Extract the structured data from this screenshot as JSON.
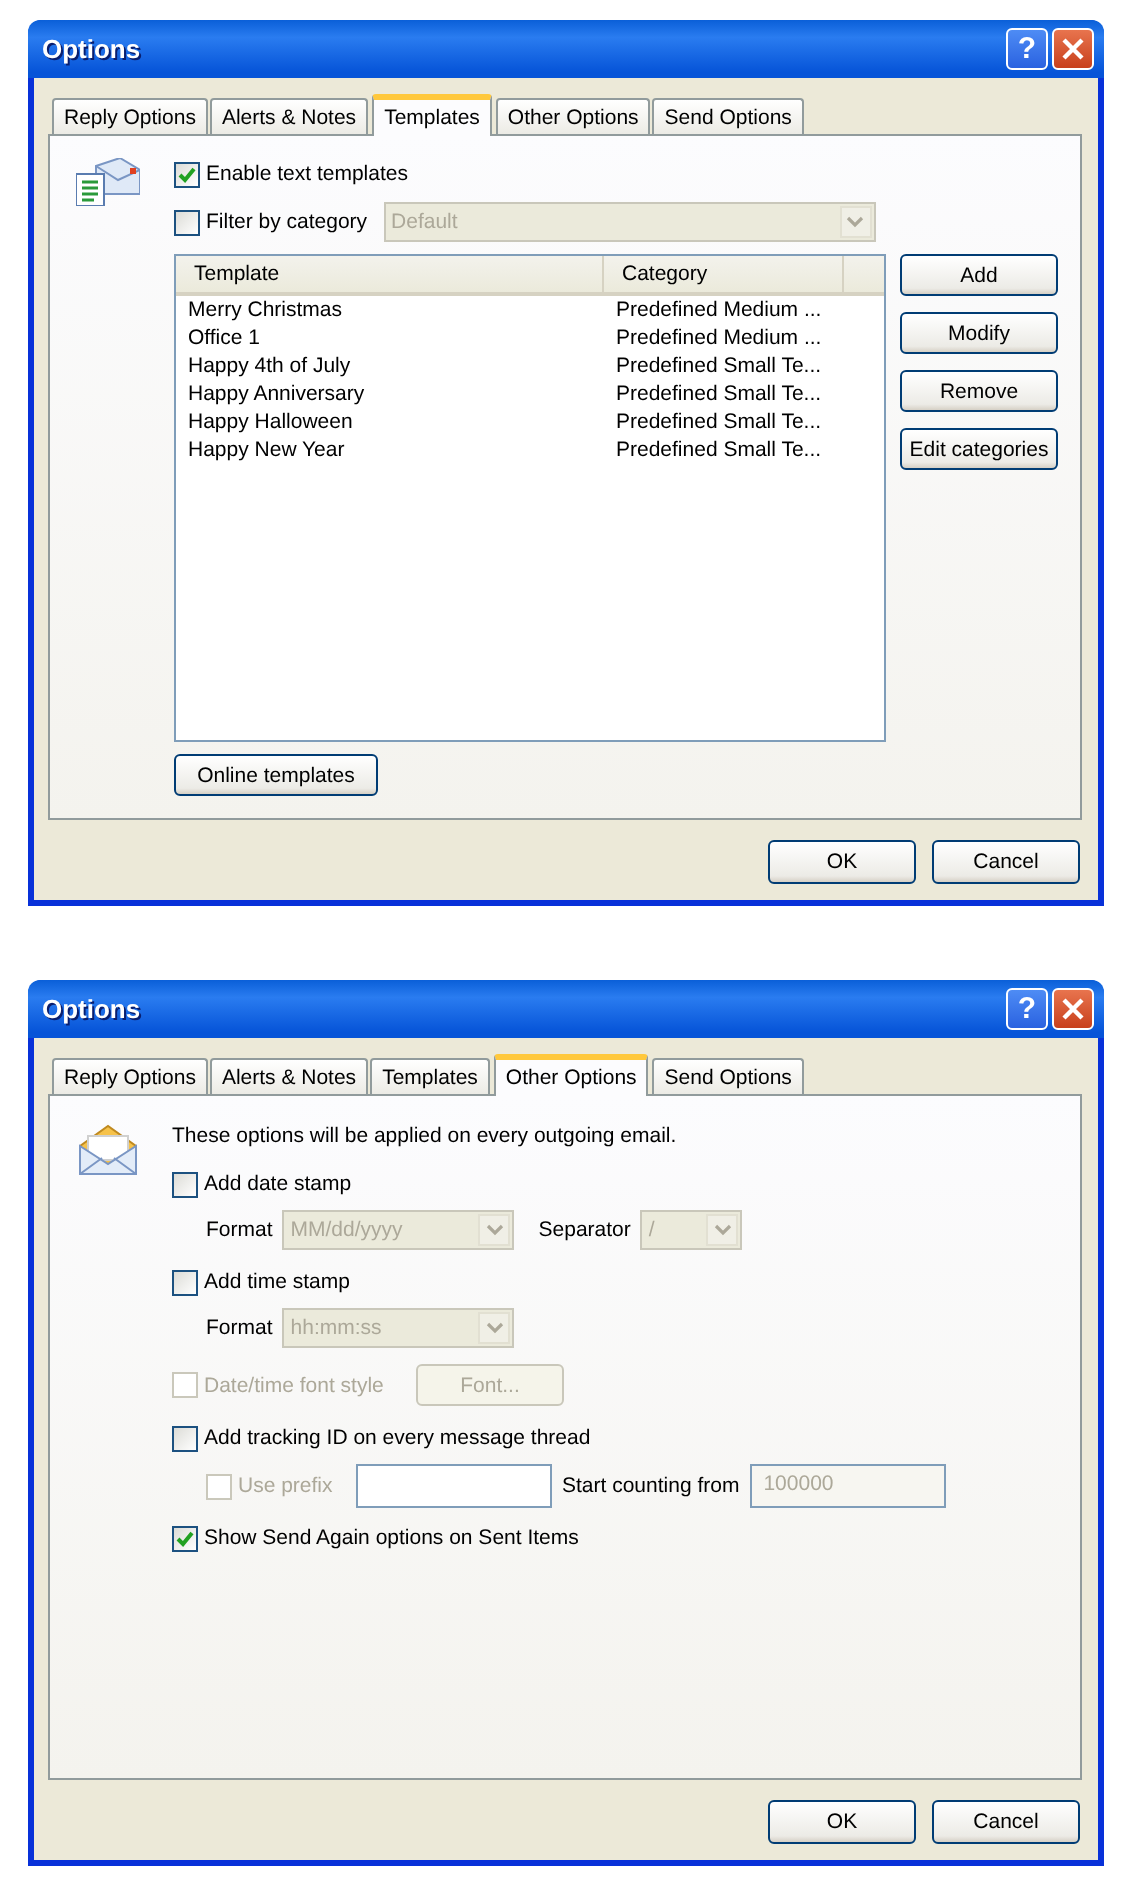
{
  "dialogs": [
    {
      "title": "Options",
      "help_glyph": "?",
      "tabs": [
        {
          "label": "Reply Options",
          "selected": false
        },
        {
          "label": "Alerts & Notes",
          "selected": false
        },
        {
          "label": "Templates",
          "selected": true
        },
        {
          "label": "Other Options",
          "selected": false
        },
        {
          "label": "Send Options",
          "selected": false
        }
      ],
      "page": {
        "kind": "templates",
        "enable": {
          "label": "Enable text templates",
          "checked": true
        },
        "filter": {
          "label": "Filter by category",
          "checked": false
        },
        "category_dropdown": {
          "value": "Default",
          "disabled": true
        },
        "columns": [
          "Template",
          "Category"
        ],
        "rows": [
          {
            "template": "Merry Christmas",
            "category": "Predefined Medium ..."
          },
          {
            "template": "Office 1",
            "category": "Predefined Medium ..."
          },
          {
            "template": "Happy 4th of July",
            "category": "Predefined Small Te..."
          },
          {
            "template": "Happy Anniversary",
            "category": "Predefined Small Te..."
          },
          {
            "template": "Happy Halloween",
            "category": "Predefined Small Te..."
          },
          {
            "template": "Happy New Year",
            "category": "Predefined Small Te..."
          }
        ],
        "side_buttons": [
          "Add",
          "Modify",
          "Remove",
          "Edit categories"
        ],
        "online_button": "Online templates"
      },
      "buttons": [
        "OK",
        "Cancel"
      ]
    },
    {
      "title": "Options",
      "help_glyph": "?",
      "tabs": [
        {
          "label": "Reply Options",
          "selected": false
        },
        {
          "label": "Alerts & Notes",
          "selected": false
        },
        {
          "label": "Templates",
          "selected": false
        },
        {
          "label": "Other Options",
          "selected": true
        },
        {
          "label": "Send Options",
          "selected": false
        }
      ],
      "page": {
        "kind": "other",
        "intro": "These options will be applied on every outgoing email.",
        "date_stamp": {
          "label": "Add date stamp",
          "checked": false,
          "disabled": false
        },
        "date_format": {
          "label": "Format",
          "value": "MM/dd/yyyy",
          "disabled": true
        },
        "separator": {
          "label": "Separator",
          "value": "/",
          "disabled": true
        },
        "time_stamp": {
          "label": "Add time stamp",
          "checked": false,
          "disabled": false
        },
        "time_format": {
          "label": "Format",
          "value": "hh:mm:ss",
          "disabled": true
        },
        "font_style": {
          "label": "Date/time font style",
          "checked": false,
          "disabled": true
        },
        "font_button": {
          "label": "Font...",
          "disabled": true
        },
        "tracking": {
          "label": "Add tracking ID on every message thread",
          "checked": false,
          "disabled": false
        },
        "use_prefix": {
          "label": "Use prefix",
          "checked": false,
          "disabled": true
        },
        "start_counting": {
          "label": "Start counting from",
          "value": "100000",
          "disabled": true
        },
        "send_again": {
          "label": "Show Send Again options on Sent Items",
          "checked": true,
          "disabled": false
        }
      },
      "buttons": [
        "OK",
        "Cancel"
      ]
    }
  ]
}
